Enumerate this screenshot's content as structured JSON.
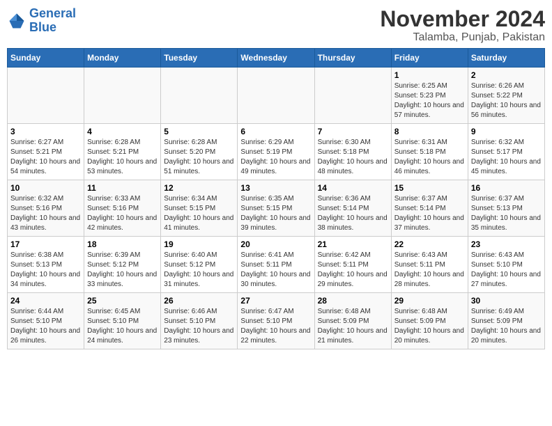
{
  "header": {
    "logo_line1": "General",
    "logo_line2": "Blue",
    "title": "November 2024",
    "subtitle": "Talamba, Punjab, Pakistan"
  },
  "weekdays": [
    "Sunday",
    "Monday",
    "Tuesday",
    "Wednesday",
    "Thursday",
    "Friday",
    "Saturday"
  ],
  "weeks": [
    [
      {
        "day": "",
        "sunrise": "",
        "sunset": "",
        "daylight": ""
      },
      {
        "day": "",
        "sunrise": "",
        "sunset": "",
        "daylight": ""
      },
      {
        "day": "",
        "sunrise": "",
        "sunset": "",
        "daylight": ""
      },
      {
        "day": "",
        "sunrise": "",
        "sunset": "",
        "daylight": ""
      },
      {
        "day": "",
        "sunrise": "",
        "sunset": "",
        "daylight": ""
      },
      {
        "day": "1",
        "sunrise": "Sunrise: 6:25 AM",
        "sunset": "Sunset: 5:23 PM",
        "daylight": "Daylight: 10 hours and 57 minutes."
      },
      {
        "day": "2",
        "sunrise": "Sunrise: 6:26 AM",
        "sunset": "Sunset: 5:22 PM",
        "daylight": "Daylight: 10 hours and 56 minutes."
      }
    ],
    [
      {
        "day": "3",
        "sunrise": "Sunrise: 6:27 AM",
        "sunset": "Sunset: 5:21 PM",
        "daylight": "Daylight: 10 hours and 54 minutes."
      },
      {
        "day": "4",
        "sunrise": "Sunrise: 6:28 AM",
        "sunset": "Sunset: 5:21 PM",
        "daylight": "Daylight: 10 hours and 53 minutes."
      },
      {
        "day": "5",
        "sunrise": "Sunrise: 6:28 AM",
        "sunset": "Sunset: 5:20 PM",
        "daylight": "Daylight: 10 hours and 51 minutes."
      },
      {
        "day": "6",
        "sunrise": "Sunrise: 6:29 AM",
        "sunset": "Sunset: 5:19 PM",
        "daylight": "Daylight: 10 hours and 49 minutes."
      },
      {
        "day": "7",
        "sunrise": "Sunrise: 6:30 AM",
        "sunset": "Sunset: 5:18 PM",
        "daylight": "Daylight: 10 hours and 48 minutes."
      },
      {
        "day": "8",
        "sunrise": "Sunrise: 6:31 AM",
        "sunset": "Sunset: 5:18 PM",
        "daylight": "Daylight: 10 hours and 46 minutes."
      },
      {
        "day": "9",
        "sunrise": "Sunrise: 6:32 AM",
        "sunset": "Sunset: 5:17 PM",
        "daylight": "Daylight: 10 hours and 45 minutes."
      }
    ],
    [
      {
        "day": "10",
        "sunrise": "Sunrise: 6:32 AM",
        "sunset": "Sunset: 5:16 PM",
        "daylight": "Daylight: 10 hours and 43 minutes."
      },
      {
        "day": "11",
        "sunrise": "Sunrise: 6:33 AM",
        "sunset": "Sunset: 5:16 PM",
        "daylight": "Daylight: 10 hours and 42 minutes."
      },
      {
        "day": "12",
        "sunrise": "Sunrise: 6:34 AM",
        "sunset": "Sunset: 5:15 PM",
        "daylight": "Daylight: 10 hours and 41 minutes."
      },
      {
        "day": "13",
        "sunrise": "Sunrise: 6:35 AM",
        "sunset": "Sunset: 5:15 PM",
        "daylight": "Daylight: 10 hours and 39 minutes."
      },
      {
        "day": "14",
        "sunrise": "Sunrise: 6:36 AM",
        "sunset": "Sunset: 5:14 PM",
        "daylight": "Daylight: 10 hours and 38 minutes."
      },
      {
        "day": "15",
        "sunrise": "Sunrise: 6:37 AM",
        "sunset": "Sunset: 5:14 PM",
        "daylight": "Daylight: 10 hours and 37 minutes."
      },
      {
        "day": "16",
        "sunrise": "Sunrise: 6:37 AM",
        "sunset": "Sunset: 5:13 PM",
        "daylight": "Daylight: 10 hours and 35 minutes."
      }
    ],
    [
      {
        "day": "17",
        "sunrise": "Sunrise: 6:38 AM",
        "sunset": "Sunset: 5:13 PM",
        "daylight": "Daylight: 10 hours and 34 minutes."
      },
      {
        "day": "18",
        "sunrise": "Sunrise: 6:39 AM",
        "sunset": "Sunset: 5:12 PM",
        "daylight": "Daylight: 10 hours and 33 minutes."
      },
      {
        "day": "19",
        "sunrise": "Sunrise: 6:40 AM",
        "sunset": "Sunset: 5:12 PM",
        "daylight": "Daylight: 10 hours and 31 minutes."
      },
      {
        "day": "20",
        "sunrise": "Sunrise: 6:41 AM",
        "sunset": "Sunset: 5:11 PM",
        "daylight": "Daylight: 10 hours and 30 minutes."
      },
      {
        "day": "21",
        "sunrise": "Sunrise: 6:42 AM",
        "sunset": "Sunset: 5:11 PM",
        "daylight": "Daylight: 10 hours and 29 minutes."
      },
      {
        "day": "22",
        "sunrise": "Sunrise: 6:43 AM",
        "sunset": "Sunset: 5:11 PM",
        "daylight": "Daylight: 10 hours and 28 minutes."
      },
      {
        "day": "23",
        "sunrise": "Sunrise: 6:43 AM",
        "sunset": "Sunset: 5:10 PM",
        "daylight": "Daylight: 10 hours and 27 minutes."
      }
    ],
    [
      {
        "day": "24",
        "sunrise": "Sunrise: 6:44 AM",
        "sunset": "Sunset: 5:10 PM",
        "daylight": "Daylight: 10 hours and 26 minutes."
      },
      {
        "day": "25",
        "sunrise": "Sunrise: 6:45 AM",
        "sunset": "Sunset: 5:10 PM",
        "daylight": "Daylight: 10 hours and 24 minutes."
      },
      {
        "day": "26",
        "sunrise": "Sunrise: 6:46 AM",
        "sunset": "Sunset: 5:10 PM",
        "daylight": "Daylight: 10 hours and 23 minutes."
      },
      {
        "day": "27",
        "sunrise": "Sunrise: 6:47 AM",
        "sunset": "Sunset: 5:10 PM",
        "daylight": "Daylight: 10 hours and 22 minutes."
      },
      {
        "day": "28",
        "sunrise": "Sunrise: 6:48 AM",
        "sunset": "Sunset: 5:09 PM",
        "daylight": "Daylight: 10 hours and 21 minutes."
      },
      {
        "day": "29",
        "sunrise": "Sunrise: 6:48 AM",
        "sunset": "Sunset: 5:09 PM",
        "daylight": "Daylight: 10 hours and 20 minutes."
      },
      {
        "day": "30",
        "sunrise": "Sunrise: 6:49 AM",
        "sunset": "Sunset: 5:09 PM",
        "daylight": "Daylight: 10 hours and 20 minutes."
      }
    ]
  ]
}
